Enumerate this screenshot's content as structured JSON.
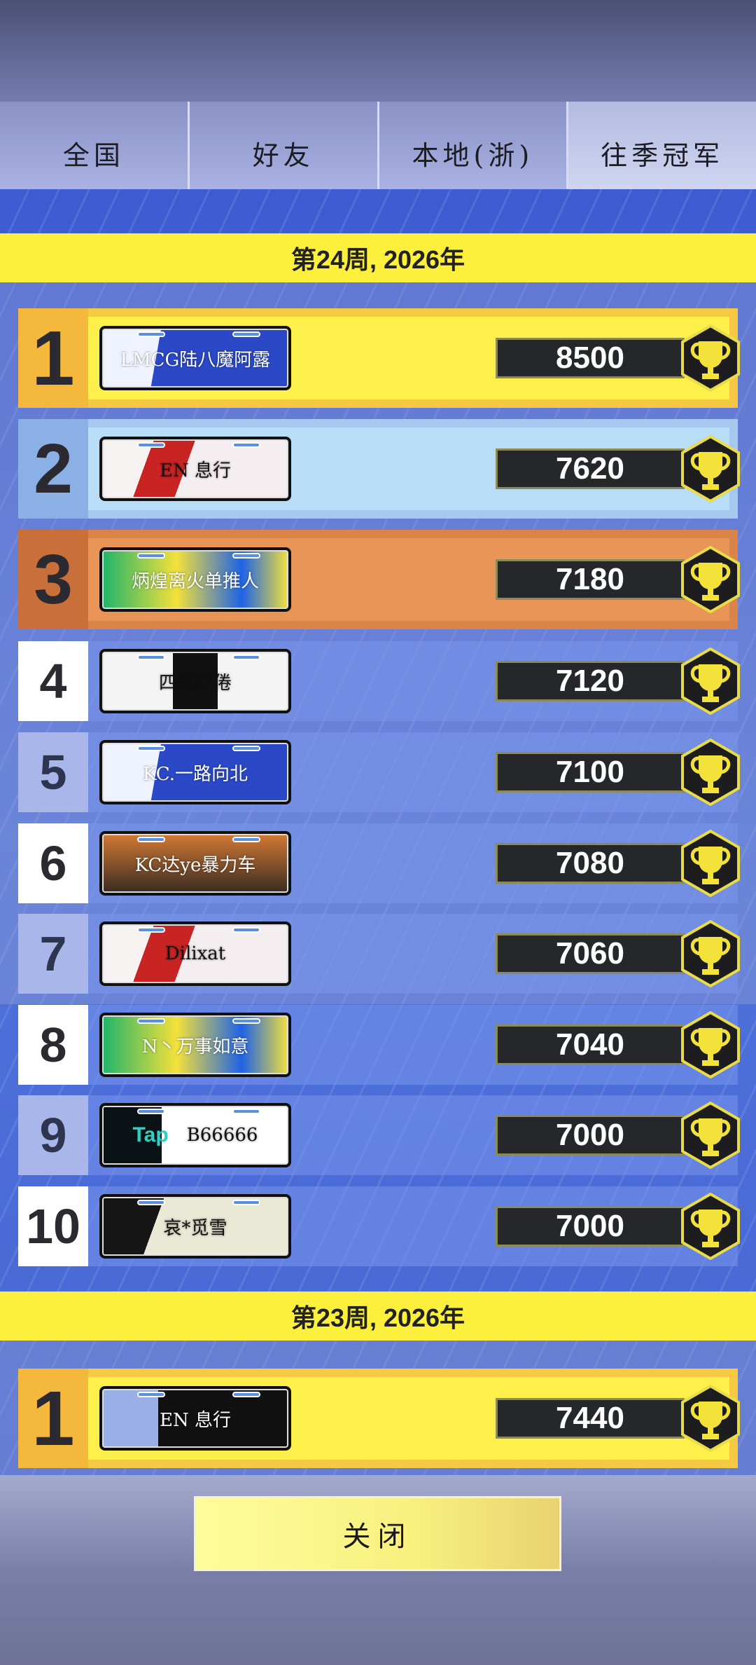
{
  "tabs": [
    {
      "label": "全国"
    },
    {
      "label": "好友"
    },
    {
      "label": "本地(浙)"
    },
    {
      "label": "往季冠军"
    }
  ],
  "weeks": [
    {
      "title": "第24周, 2026年",
      "entries": [
        {
          "rank": "1",
          "plate": "LMCG陆八魔阿露",
          "score": "8500"
        },
        {
          "rank": "2",
          "plate": "EN 息行",
          "score": "7620"
        },
        {
          "rank": "3",
          "plate": "炳煌离火单推人",
          "score": "7180"
        },
        {
          "rank": "4",
          "plate": "四到厌倦",
          "score": "7120"
        },
        {
          "rank": "5",
          "plate": "KC.一路向北",
          "score": "7100"
        },
        {
          "rank": "6",
          "plate": "KC达ye暴力车",
          "score": "7080"
        },
        {
          "rank": "7",
          "plate": "Dilixat",
          "score": "7060"
        },
        {
          "rank": "8",
          "plate": "N丶万事如意",
          "score": "7040"
        },
        {
          "rank": "9",
          "plate": "B66666",
          "plate_tag": "Tap",
          "score": "7000"
        },
        {
          "rank": "10",
          "plate": "哀*觅雪",
          "score": "7000"
        }
      ]
    },
    {
      "title": "第23周, 2026年",
      "entries": [
        {
          "rank": "1",
          "plate": "EN 息行",
          "score": "7440"
        }
      ]
    }
  ],
  "close_label": "关闭",
  "icons": {
    "trophy": "trophy-icon"
  },
  "colors": {
    "gold": "#fdf04a",
    "silver": "#b9ddf6",
    "bronze": "#e99558",
    "banner": "#fcf03c",
    "score_bg": "#26272b"
  }
}
